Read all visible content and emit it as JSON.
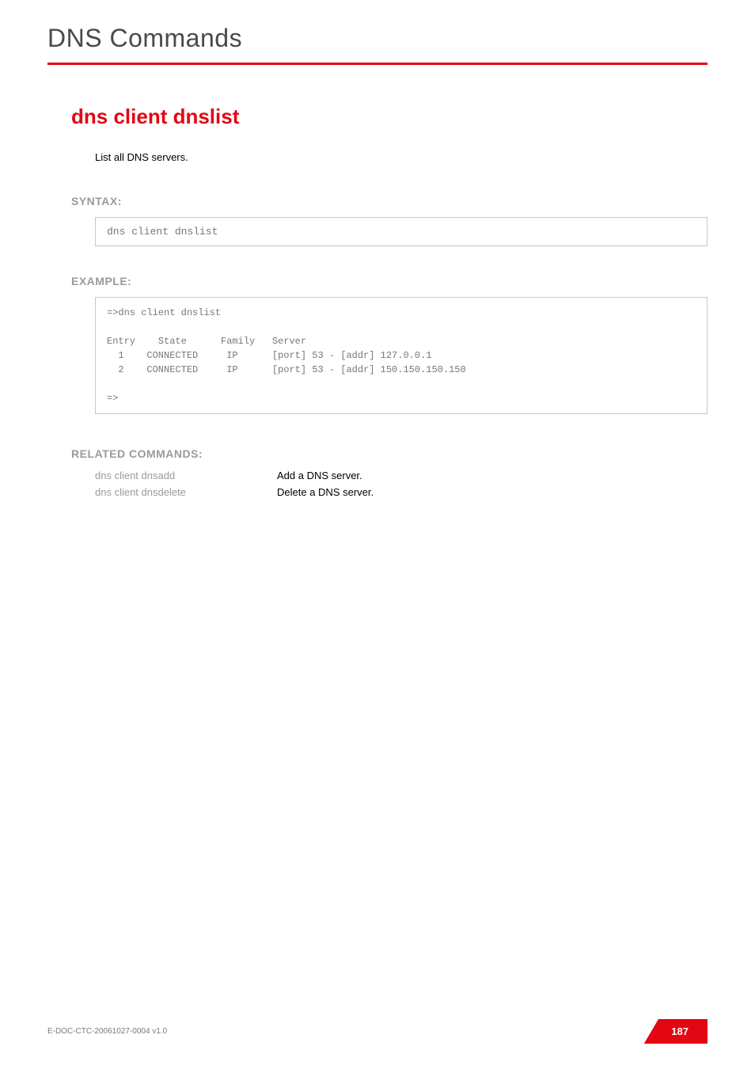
{
  "chapter": "DNS Commands",
  "command": {
    "title": "dns client dnslist",
    "description": "List all DNS servers."
  },
  "sections": {
    "syntax_heading": "SYNTAX:",
    "syntax_text": "dns client dnslist",
    "example_heading": "EXAMPLE:",
    "example_text": "=>dns client dnslist\n\nEntry    State      Family   Server\n  1    CONNECTED     IP      [port] 53 - [addr] 127.0.0.1\n  2    CONNECTED     IP      [port] 53 - [addr] 150.150.150.150\n\n=>",
    "related_heading": "RELATED COMMANDS:"
  },
  "related": [
    {
      "cmd": "dns client dnsadd",
      "desc": "Add a DNS server."
    },
    {
      "cmd": "dns client dnsdelete",
      "desc": "Delete a DNS server."
    }
  ],
  "footer": {
    "doc_id": "E-DOC-CTC-20061027-0004 v1.0",
    "page": "187"
  }
}
